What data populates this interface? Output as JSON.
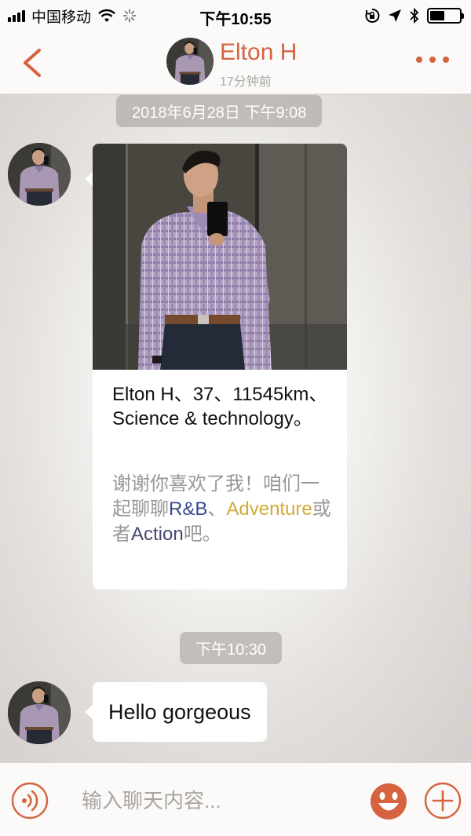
{
  "status_bar": {
    "carrier": "中国移动",
    "time": "下午10:55",
    "battery_level": 0.5
  },
  "header": {
    "contact_name": "Elton H",
    "last_seen": "17分钟前"
  },
  "messages": {
    "first_timestamp": "2018年6月28日 下午9:08",
    "profile_card": {
      "profile_line": "Elton H、37、11545km、Science & technology。",
      "greeting_prefix": "谢谢你喜欢了我！咱们一起聊聊",
      "tag_1": "R&B",
      "separator": "、",
      "tag_2": "Adventure",
      "connector": "或者",
      "tag_3": "Action",
      "greeting_suffix": "吧。"
    },
    "second_timestamp": "下午10:30",
    "text_message": "Hello gorgeous"
  },
  "input": {
    "placeholder": "输入聊天内容..."
  },
  "colors": {
    "accent": "#d5633f",
    "tag_rb": "#3a4a8c",
    "tag_adventure": "#d2aa3a",
    "tag_action": "#454870"
  }
}
